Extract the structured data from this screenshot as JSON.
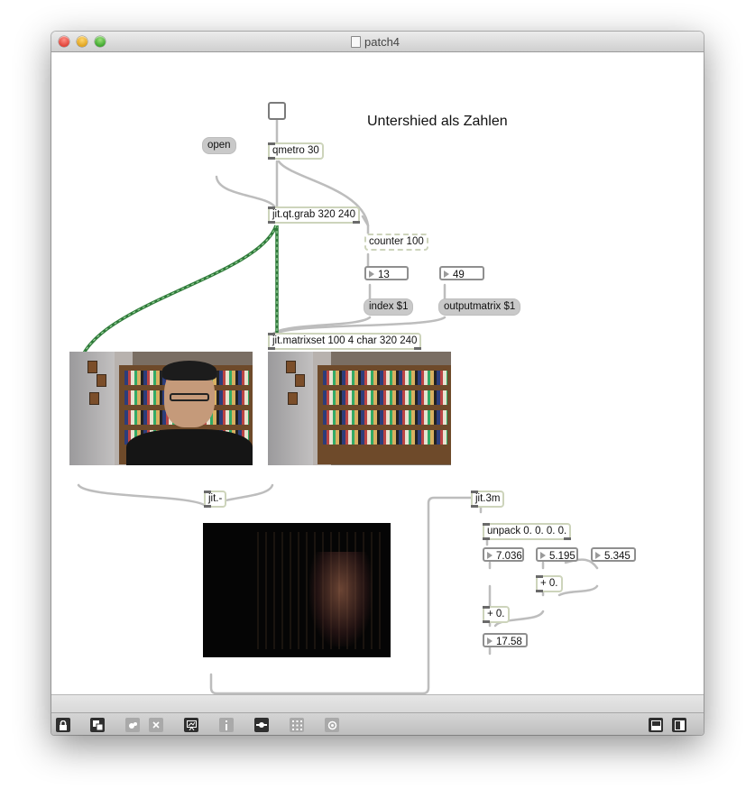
{
  "window": {
    "title": "patch4",
    "icons": {
      "close": "close-traffic-light",
      "minimize": "minimize-traffic-light",
      "zoom": "zoom-traffic-light",
      "document": "document-icon"
    },
    "colors": {
      "close": "#e0443a",
      "minimize": "#e0a420",
      "zoom": "#3fa72f"
    }
  },
  "patch": {
    "comment": "Untershied als Zahlen",
    "objects": {
      "qmetro": "qmetro 30",
      "qtgrab": "jit.qt.grab 320 240",
      "counter": "counter 100",
      "matrixset": "jit.matrixset 100 4 char 320 240",
      "jitminus": "jit.-",
      "jit3m": "jit.3m",
      "unpack": "unpack 0. 0. 0. 0.",
      "plus1": "+ 0.",
      "plus2": "+ 0."
    },
    "messages": {
      "open": "open",
      "index": "index $1",
      "outputmatrix": "outputmatrix $1"
    },
    "numbers": {
      "counter_out": "13",
      "output_index": "49",
      "mean1": "7.036",
      "mean2": "5.195",
      "mean3": "5.345",
      "sum": "17.58"
    },
    "colors": {
      "object_border": "#cdd4bb",
      "message_bg": "#c9c9c9",
      "patch_cord": "#bdbdbd",
      "matrix_cord": "#2f7a3a"
    }
  },
  "toolbar": {
    "icons": [
      "lock-icon",
      "presentation-icon",
      "clipboard-icon",
      "close-box-icon",
      "inspector-icon",
      "info-icon",
      "slider-icon",
      "grid-icon",
      "snap-icon",
      "split-horizontal-icon",
      "split-vertical-icon"
    ]
  }
}
